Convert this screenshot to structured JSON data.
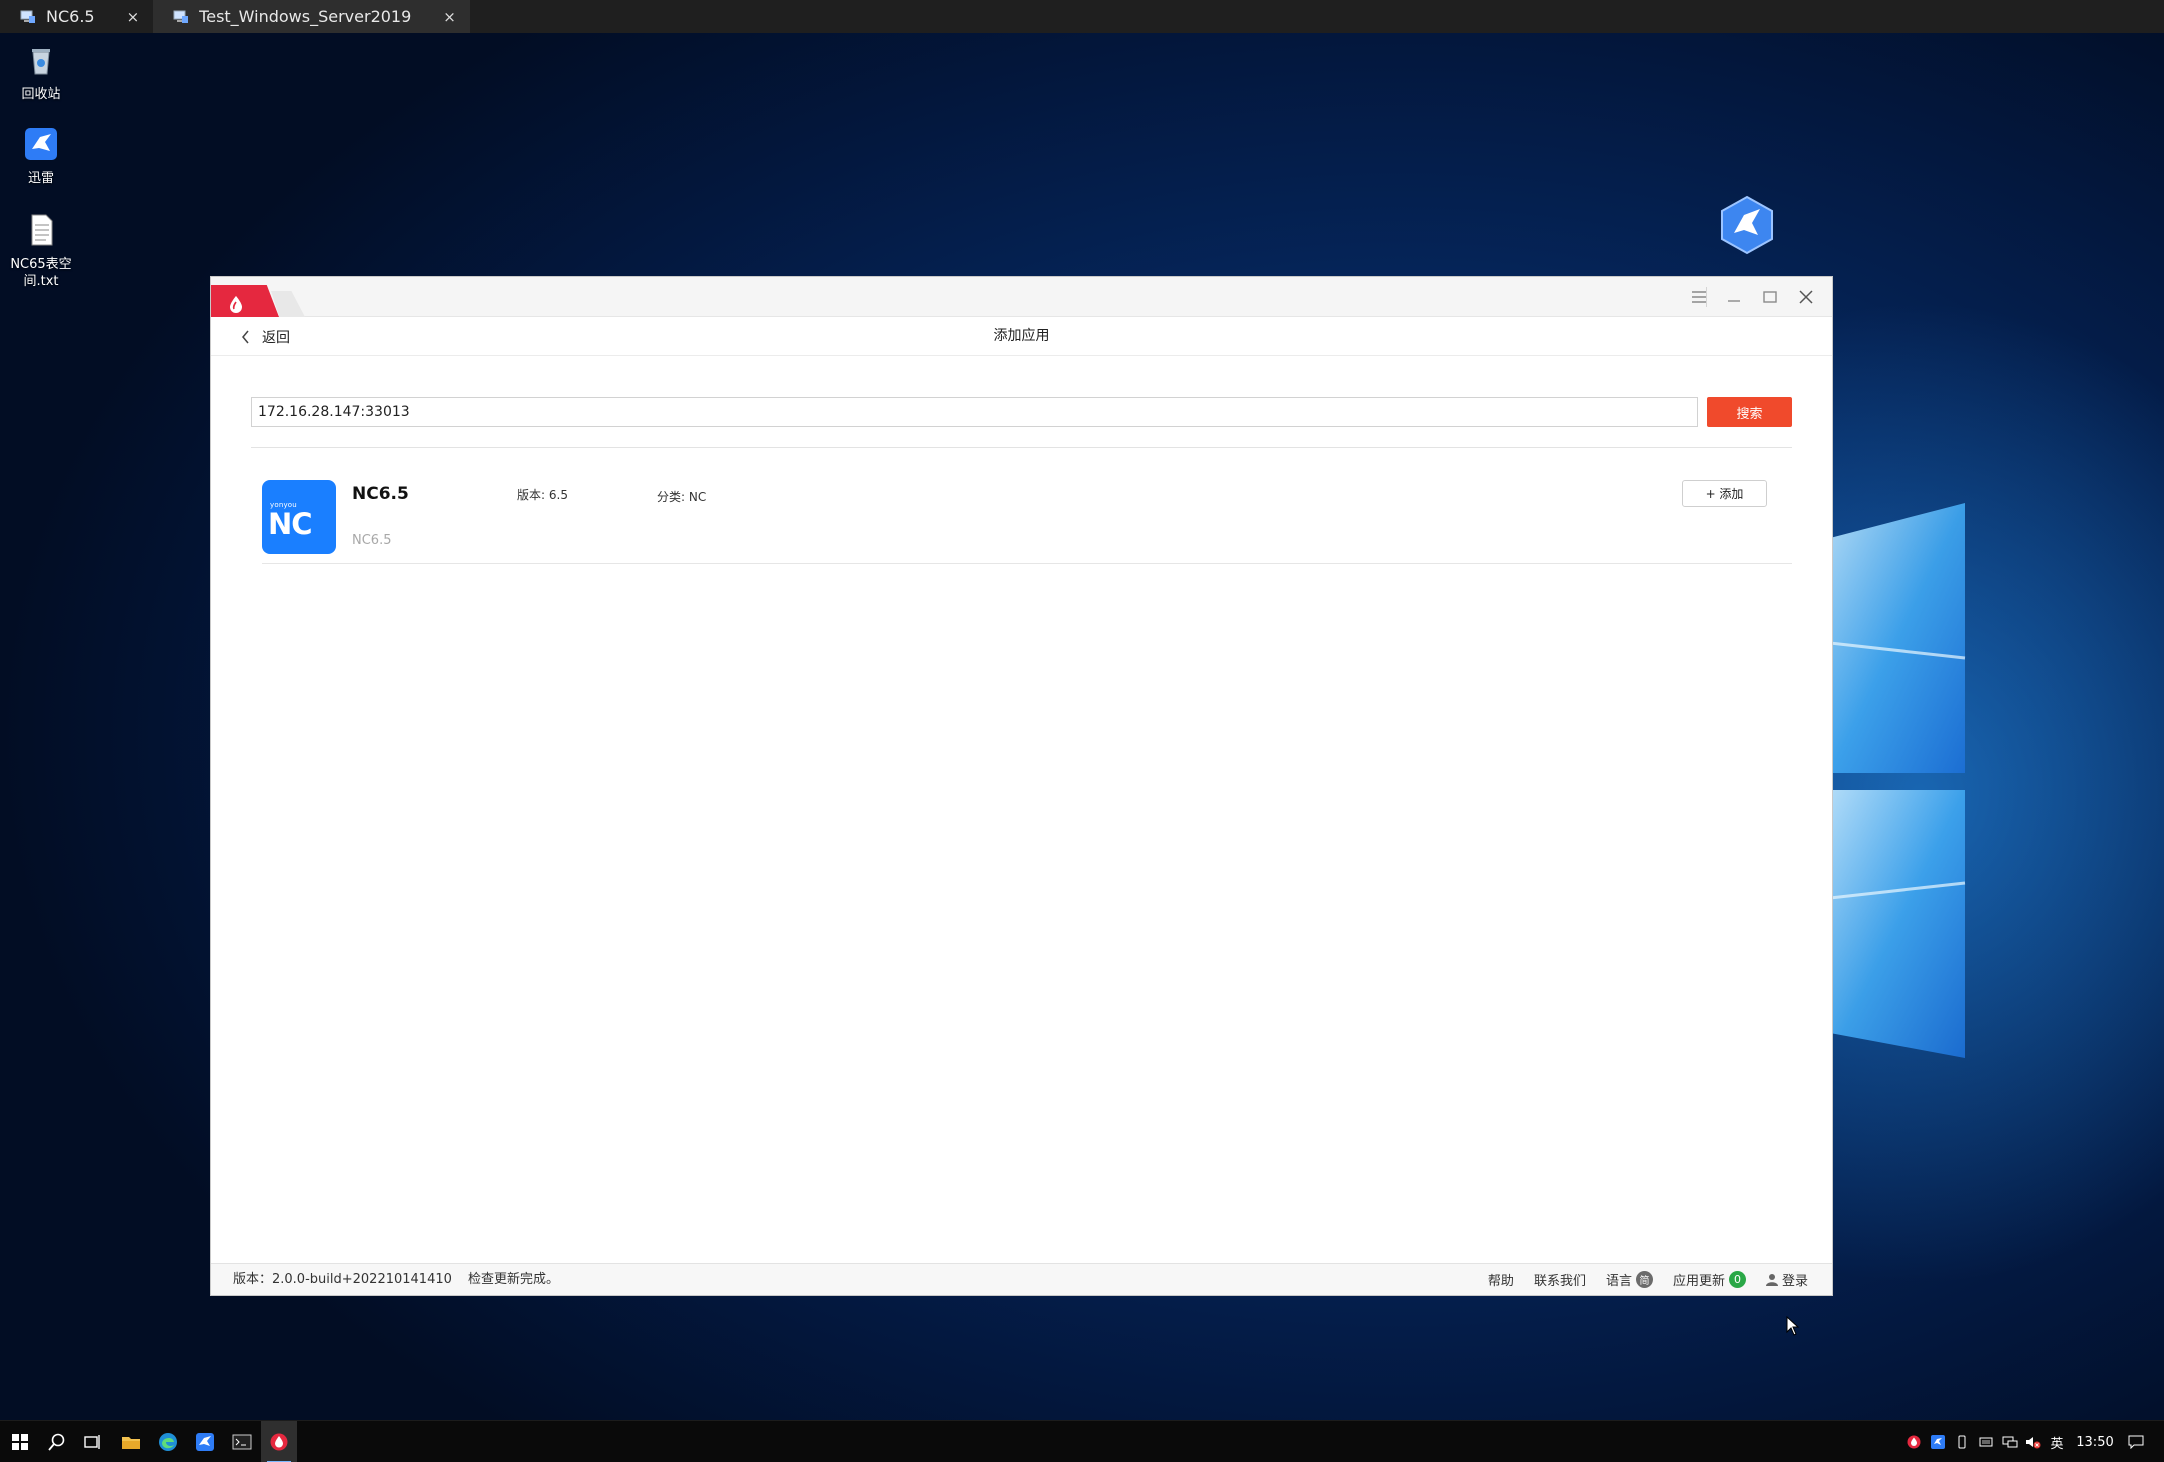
{
  "remote_tabs": [
    {
      "label": "NC6.5",
      "close": "×"
    },
    {
      "label": "Test_Windows_Server2019",
      "close": "×"
    }
  ],
  "desktop": {
    "icons": [
      {
        "label": "回收站"
      },
      {
        "label": "迅雷"
      },
      {
        "label": "NC65表空间.txt"
      }
    ]
  },
  "app_window": {
    "back_label": "返回",
    "page_title": "添加应用",
    "search": {
      "value": "172.16.28.147:33013",
      "button_label": "搜索"
    },
    "results": [
      {
        "logo_brand": "yonyou",
        "logo_text": "NC",
        "name": "NC6.5",
        "subtitle": "NC6.5",
        "version_label": "版本:",
        "version_value": "6.5",
        "category_label": "分类:",
        "category_value": "NC",
        "add_label": "+ 添加"
      }
    ],
    "status_bar": {
      "version": "版本：2.0.0-build+202210141410",
      "update_message": "检查更新完成。",
      "help": "帮助",
      "contact": "联系我们",
      "language": "语言",
      "language_badge": "简",
      "app_update": "应用更新",
      "app_update_count": "0",
      "login": "登录"
    }
  },
  "taskbar": {
    "ime": "英",
    "clock": "13:50"
  },
  "colors": {
    "accent_red": "#e5283f",
    "search_button": "#f04a2c",
    "nc_blue": "#1a7fff",
    "update_green": "#2aa847"
  }
}
